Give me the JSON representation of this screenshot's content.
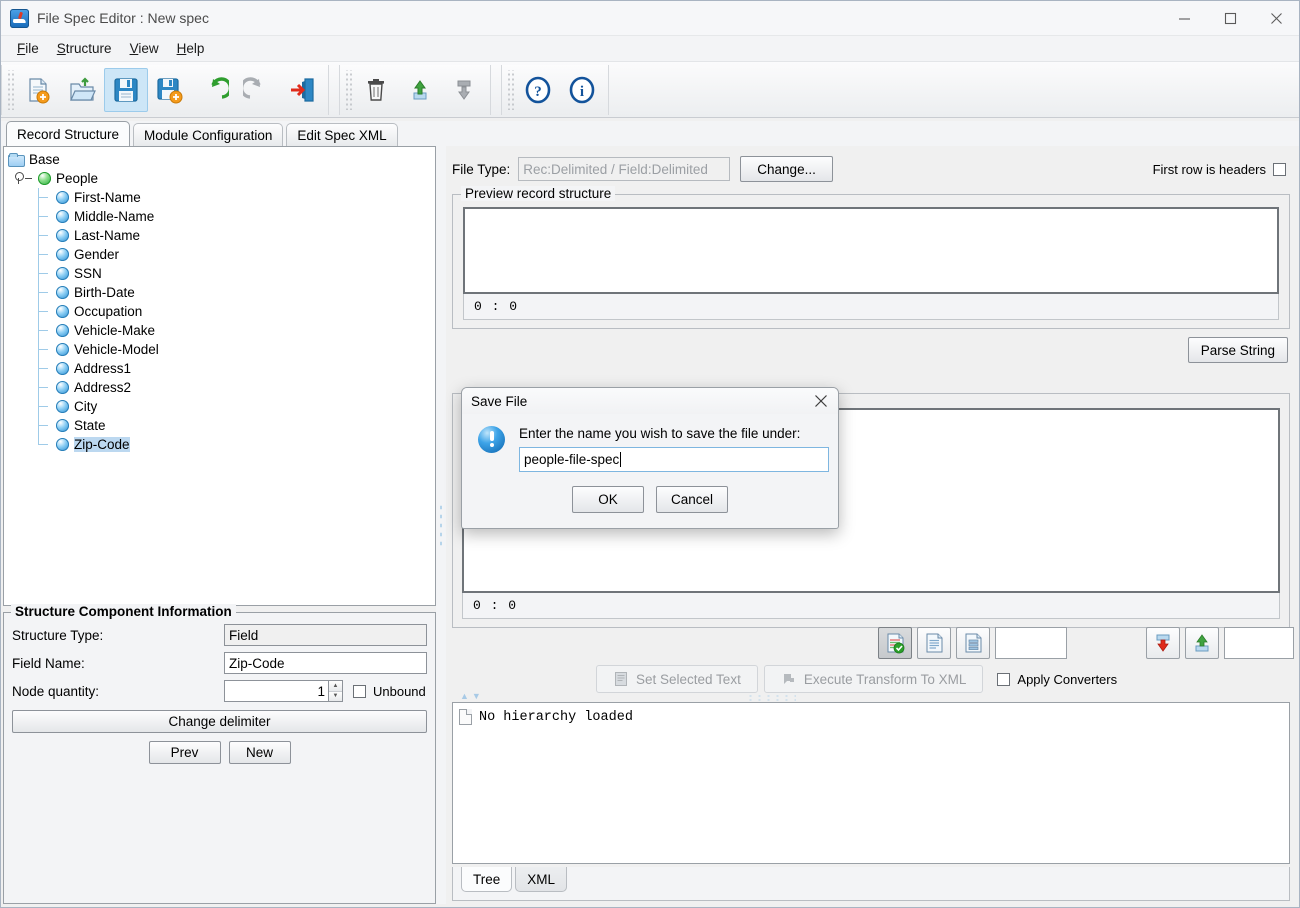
{
  "window": {
    "title": "File Spec Editor : New spec",
    "app_icon": "app-logo-icon",
    "minimize": "—",
    "maximize": "□",
    "close": "✕"
  },
  "menubar": {
    "items": [
      {
        "label": "File",
        "mnemonic": "F"
      },
      {
        "label": "Structure",
        "mnemonic": "S"
      },
      {
        "label": "View",
        "mnemonic": "V"
      },
      {
        "label": "Help",
        "mnemonic": "H"
      }
    ]
  },
  "toolbar": {
    "groups": [
      {
        "buttons": [
          {
            "name": "new-spec-button",
            "icon": "new-document-icon",
            "active": false
          },
          {
            "name": "open-spec-button",
            "icon": "open-folder-icon",
            "active": false
          },
          {
            "name": "save-spec-button",
            "icon": "save-disk-icon",
            "active": true
          },
          {
            "name": "save-as-spec-button",
            "icon": "save-as-disk-icon",
            "active": false
          },
          {
            "name": "undo-button",
            "icon": "undo-arrow-icon",
            "active": false
          },
          {
            "name": "redo-button",
            "icon": "redo-arrow-icon",
            "active": false
          },
          {
            "name": "exit-button",
            "icon": "exit-door-icon",
            "active": false
          }
        ]
      },
      {
        "buttons": [
          {
            "name": "delete-button",
            "icon": "trash-can-icon",
            "active": false
          },
          {
            "name": "move-up-button",
            "icon": "arrow-up-icon",
            "active": false
          },
          {
            "name": "move-down-button",
            "icon": "arrow-down-icon",
            "active": false
          }
        ]
      },
      {
        "buttons": [
          {
            "name": "help-button",
            "icon": "question-mark-icon",
            "active": false
          },
          {
            "name": "about-button",
            "icon": "info-icon",
            "active": false
          }
        ]
      }
    ]
  },
  "tabs": {
    "items": [
      {
        "label": "Record Structure",
        "selected": true
      },
      {
        "label": "Module Configuration",
        "selected": false
      },
      {
        "label": "Edit Spec XML",
        "selected": false
      }
    ]
  },
  "tree": {
    "root": {
      "label": "Base",
      "icon": "folder-icon"
    },
    "group": {
      "label": "People",
      "icon": "green-ball-icon"
    },
    "fields": [
      "First-Name",
      "Middle-Name",
      "Last-Name",
      "Gender",
      "SSN",
      "Birth-Date",
      "Occupation",
      "Vehicle-Make",
      "Vehicle-Model",
      "Address1",
      "Address2",
      "City",
      "State",
      "Zip-Code"
    ],
    "selected": "Zip-Code"
  },
  "structure_info": {
    "legend": "Structure Component Information",
    "structure_type_label": "Structure Type:",
    "structure_type_value": "Field",
    "field_name_label": "Field Name:",
    "field_name_value": "Zip-Code",
    "node_quantity_label": "Node quantity:",
    "node_quantity_value": "1",
    "unbound_label": "Unbound",
    "unbound_checked": false,
    "change_delimiter_label": "Change delimiter",
    "prev_label": "Prev",
    "new_label": "New"
  },
  "right": {
    "file_type_label": "File Type:",
    "file_type_value": "Rec:Delimited / Field:Delimited",
    "change_label": "Change...",
    "first_row_headers_label": "First row is headers",
    "first_row_headers_checked": false,
    "preview_legend": "Preview record structure",
    "preview_text": "",
    "preview_status": "0 : 0",
    "parse_string_label": "Parse String",
    "second_text": "",
    "second_status": "0 : 0",
    "tool_buttons": [
      {
        "name": "validate-document-button",
        "icon": "document-check-icon",
        "pressed": true
      },
      {
        "name": "plain-document-button",
        "icon": "document-lines-icon",
        "pressed": false
      },
      {
        "name": "structured-document-button",
        "icon": "document-structure-icon",
        "pressed": false
      }
    ],
    "tool_field_value": "",
    "import-export": [
      {
        "name": "download-button",
        "icon": "arrow-down-red-icon"
      },
      {
        "name": "upload-button",
        "icon": "arrow-up-green-icon"
      }
    ],
    "trailing_field_value": "",
    "set_selected_text_label": "Set Selected Text",
    "execute_transform_label": "Execute Transform To XML",
    "apply_converters_label": "Apply Converters",
    "apply_converters_checked": false,
    "hierarchy_message": "No hierarchy loaded",
    "bottom_tabs": [
      {
        "label": "Tree",
        "selected": true
      },
      {
        "label": "XML",
        "selected": false
      }
    ]
  },
  "dialog": {
    "title": "Save File",
    "close_label": "✕",
    "icon": "info-exclamation-icon",
    "prompt": "Enter the name you wish to save the file under:",
    "input_value": "people-file-spec",
    "ok_label": "OK",
    "cancel_label": "Cancel"
  },
  "colors": {
    "accent_blue": "#1b84cd",
    "selection_blue": "#bcd8f0",
    "toolbar_active": "#cde6f7",
    "panel_bg": "#f3f4f6",
    "disabled_text": "#9a9da1"
  }
}
